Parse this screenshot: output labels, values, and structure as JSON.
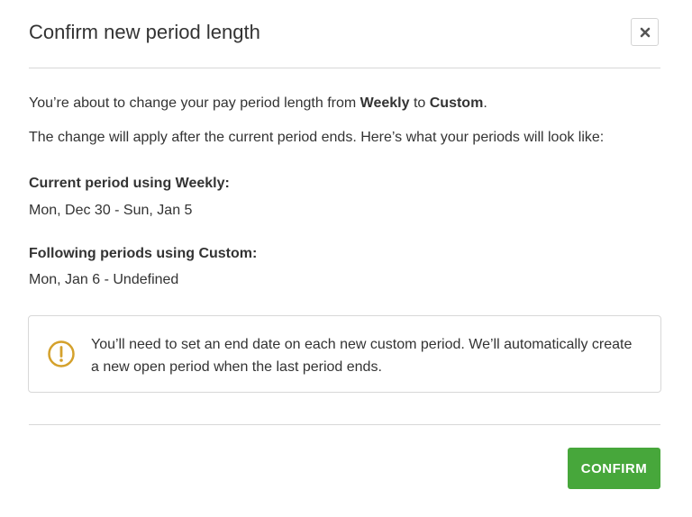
{
  "dialog": {
    "title": "Confirm new period length",
    "close_icon": "close-icon"
  },
  "body": {
    "line1": {
      "prefix": "You’re about to change your pay period length from ",
      "from": "Weekly",
      "middle": " to ",
      "to": "Custom",
      "suffix": "."
    },
    "line2": "The change will apply after the current period ends. Here’s what your periods will look like:",
    "current": {
      "heading": "Current period using Weekly:",
      "value": "Mon, Dec 30 - Sun, Jan 5"
    },
    "following": {
      "heading": "Following periods using Custom:",
      "value": "Mon, Jan 6 - Undefined"
    }
  },
  "notice": {
    "icon": "warning-circle-icon",
    "text": "You’ll need to set an end date on each new custom period. We’ll automatically create a new open period when the last period ends."
  },
  "footer": {
    "confirm_label": "CONFIRM"
  },
  "colors": {
    "confirm_bg": "#47a73b",
    "warning": "#d4a12c",
    "border": "#d8d8d8",
    "text": "#333333"
  }
}
